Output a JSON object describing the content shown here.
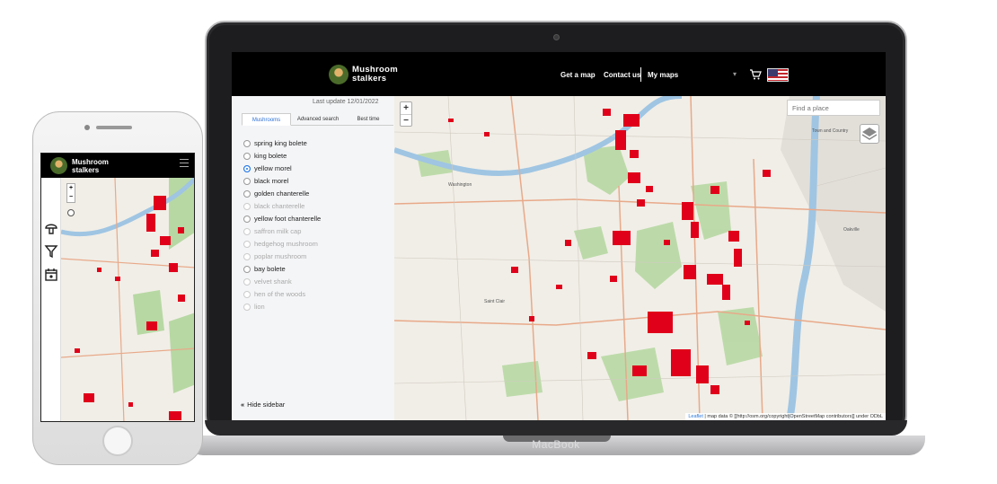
{
  "laptop": {
    "brand": "MacBook",
    "site": {
      "logo_line1": "Mushroom",
      "logo_line2": "stalkers",
      "nav": {
        "get_map": "Get a map",
        "contact": "Contact us",
        "my_maps": "My maps",
        "cart_icon": "cart-icon",
        "language_flag": "us-flag-icon"
      },
      "sidebar": {
        "last_update": "Last update 12/01/2022",
        "tabs": [
          "Mushrooms",
          "Advanced search",
          "Best time"
        ],
        "active_tab": "Mushrooms",
        "options": [
          {
            "label": "spring king bolete",
            "enabled": true,
            "selected": false
          },
          {
            "label": "king bolete",
            "enabled": true,
            "selected": false
          },
          {
            "label": "yellow morel",
            "enabled": true,
            "selected": true
          },
          {
            "label": "black morel",
            "enabled": true,
            "selected": false
          },
          {
            "label": "golden chanterelle",
            "enabled": true,
            "selected": false
          },
          {
            "label": "black chanterelle",
            "enabled": false,
            "selected": false
          },
          {
            "label": "yellow foot chanterelle",
            "enabled": true,
            "selected": false
          },
          {
            "label": "saffron milk cap",
            "enabled": false,
            "selected": false
          },
          {
            "label": "hedgehog mushroom",
            "enabled": false,
            "selected": false
          },
          {
            "label": "poplar mushroom",
            "enabled": false,
            "selected": false
          },
          {
            "label": "bay bolete",
            "enabled": true,
            "selected": false
          },
          {
            "label": "velvet shank",
            "enabled": false,
            "selected": false
          },
          {
            "label": "hen of the woods",
            "enabled": false,
            "selected": false
          },
          {
            "label": "lion",
            "enabled": false,
            "selected": false
          }
        ],
        "hide_sidebar": "Hide sidebar"
      },
      "map": {
        "zoom_in": "+",
        "zoom_out": "−",
        "find_place_placeholder": "Find a place",
        "layers_icon": "layers-icon",
        "attribution_leaflet": "Leaflet",
        "attribution_rest": " | map data © [[http://osm.org/copyright|OpenStreetMap contributors]] under ODbL",
        "hotspot_color": "#e0001a",
        "forest_color": "#b7d8a3",
        "river_color": "#9fc5e3"
      }
    }
  },
  "phone": {
    "logo_line1": "Mushroom",
    "logo_line2": "stalkers",
    "zoom_in": "+",
    "zoom_out": "−",
    "side_icons": [
      "mushroom-icon",
      "filter-icon",
      "calendar-icon"
    ],
    "expand": "»"
  }
}
